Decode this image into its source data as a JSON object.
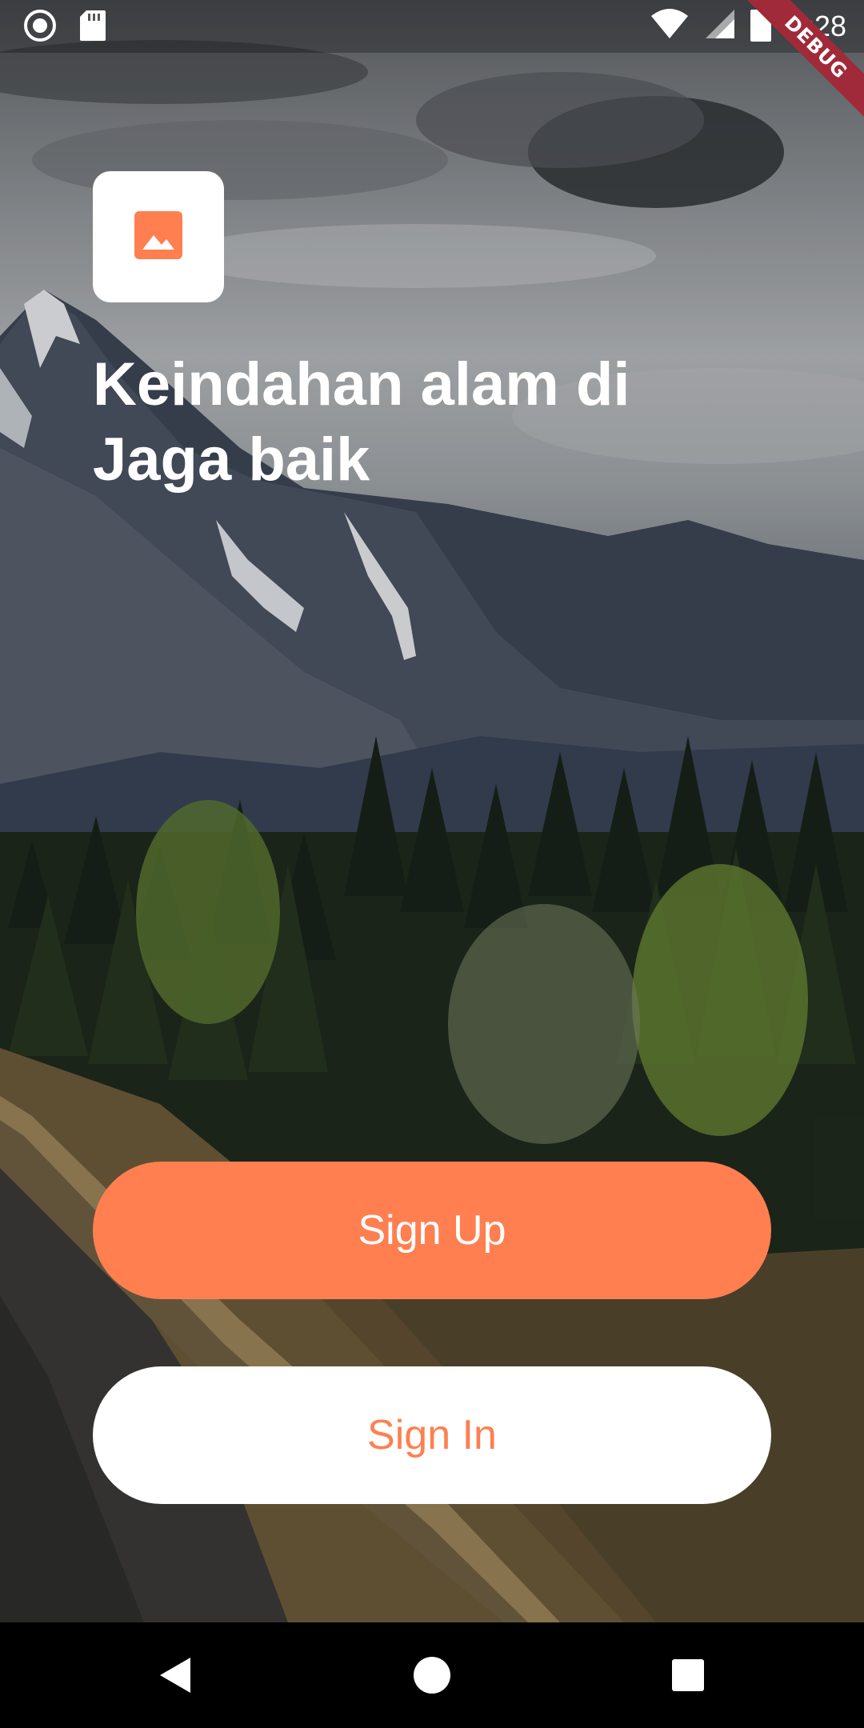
{
  "status_bar": {
    "time": "3:28",
    "debug_label": "DEBUG",
    "icons": [
      "record-icon",
      "sd-card-icon",
      "wifi-icon",
      "signal-icon",
      "battery-icon"
    ]
  },
  "logo": {
    "icon": "image-icon",
    "color": "#ff7f50"
  },
  "headline": {
    "line1": "Keindahan alam di",
    "line2": "Jaga baik"
  },
  "buttons": {
    "sign_up": "Sign Up",
    "sign_in": "Sign In"
  },
  "nav_bar": {
    "icons": [
      "back-icon",
      "home-icon",
      "recents-icon"
    ]
  },
  "colors": {
    "accent": "#ff7f50",
    "white": "#ffffff"
  }
}
